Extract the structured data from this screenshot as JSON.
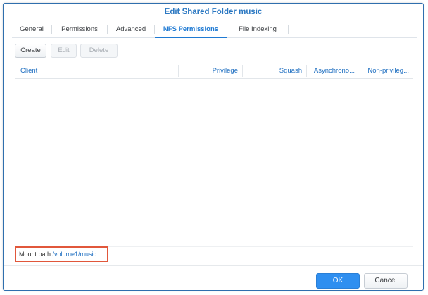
{
  "dialog": {
    "title": "Edit Shared Folder music"
  },
  "tabs": [
    {
      "label": "General"
    },
    {
      "label": "Permissions"
    },
    {
      "label": "Advanced"
    },
    {
      "label": "NFS Permissions"
    },
    {
      "label": "File Indexing"
    }
  ],
  "active_tab": "NFS Permissions",
  "toolbar": {
    "create": "Create",
    "edit": "Edit",
    "delete": "Delete"
  },
  "grid": {
    "columns": [
      "Client",
      "Privilege",
      "Squash",
      "Asynchrono...",
      "Non-privileg..."
    ],
    "rows": []
  },
  "mount": {
    "label": "Mount path:",
    "path": "/volume1/music"
  },
  "footer": {
    "ok": "OK",
    "cancel": "Cancel"
  },
  "colors": {
    "accent": "#1f7ad3",
    "ok_button": "#2f8ff0",
    "highlight_border": "#e1573b"
  }
}
